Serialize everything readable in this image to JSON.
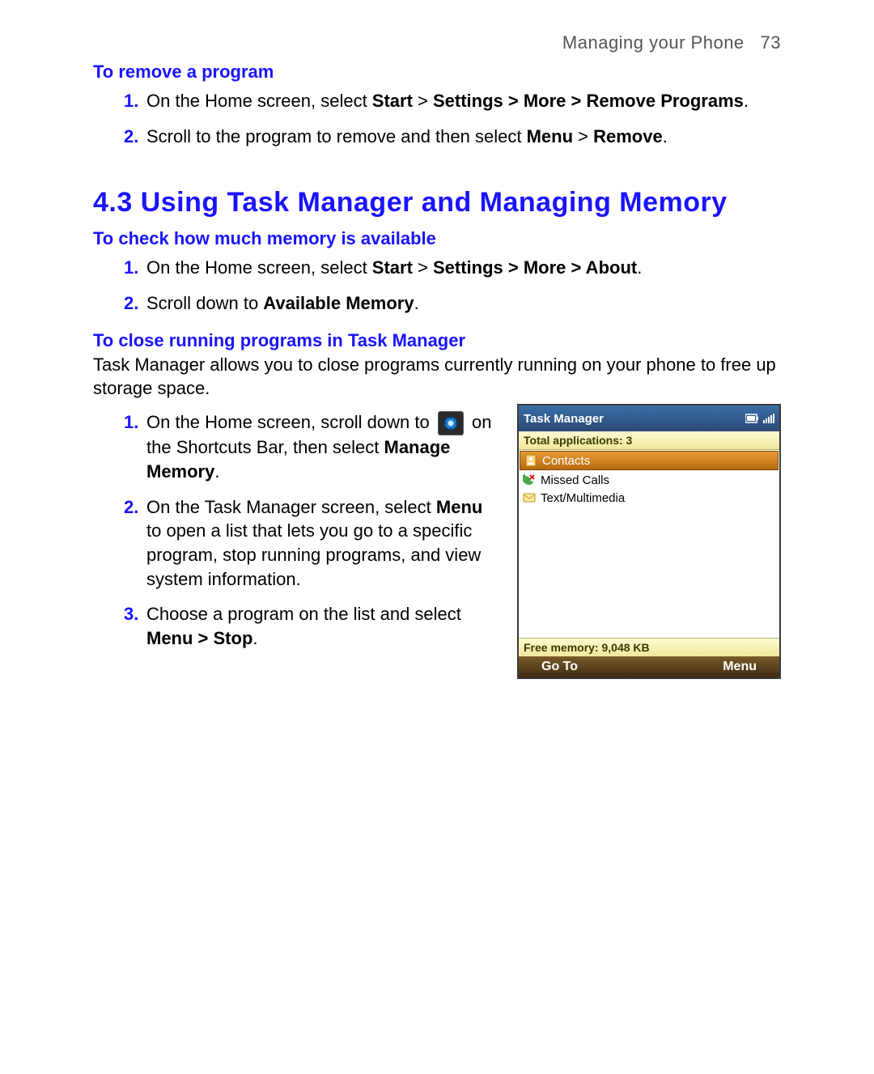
{
  "header": {
    "section": "Managing your Phone",
    "page": "73"
  },
  "remove": {
    "title": "To remove a program",
    "steps": [
      {
        "n": "1.",
        "pre": "On the Home screen, select ",
        "b": "Start",
        "mid": " > ",
        "b2": "Settings > More > Remove Programs",
        "post": "."
      },
      {
        "n": "2.",
        "pre": "Scroll to the program to remove and then select ",
        "b": "Menu",
        "mid": " > ",
        "b2": "Remove",
        "post": "."
      }
    ]
  },
  "h2": "4.3  Using Task Manager and Managing Memory",
  "check": {
    "title": "To check how much memory is available",
    "steps": [
      {
        "n": "1.",
        "pre": "On the Home screen, select ",
        "b": "Start",
        "mid": " > ",
        "b2": "Settings > More > About",
        "post": "."
      },
      {
        "n": "2.",
        "pre": "Scroll down to ",
        "b": "Available Memory",
        "post": "."
      }
    ]
  },
  "close": {
    "title": "To close running programs in Task Manager",
    "explain": "Task Manager allows you to close programs currently running on your phone to free up storage space.",
    "s1": {
      "n": "1.",
      "pre": "On the Home screen, scroll down to ",
      "post1": " on the Shortcuts Bar, then select ",
      "b": "Manage Memory",
      "post2": "."
    },
    "s2": {
      "n": "2.",
      "pre": "On the Task Manager screen, select ",
      "b": "Menu",
      "post": " to open a list that lets you go to a specific program, stop running programs, and view system information."
    },
    "s3": {
      "n": "3.",
      "pre": "Choose a program on the list and select ",
      "b": "Menu > Stop",
      "post": "."
    }
  },
  "phone": {
    "title": "Task Manager",
    "total": "Total applications: 3",
    "items": [
      {
        "label": "Contacts",
        "selected": true
      },
      {
        "label": "Missed Calls",
        "selected": false
      },
      {
        "label": "Text/Multimedia",
        "selected": false
      }
    ],
    "free": "Free memory: 9,048 KB",
    "softLeft": "Go To",
    "softRight": "Menu"
  }
}
